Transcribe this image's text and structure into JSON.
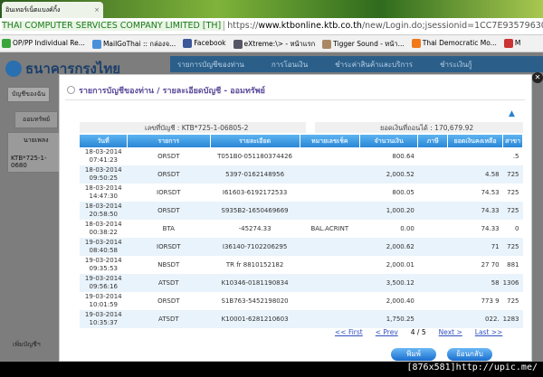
{
  "browser": {
    "tab_title": "อินเทอร์เน็ตแบงค์กิ้ง",
    "tab_close": "×",
    "ev_cert": "THAI COMPUTER SERVICES COMPANY LIMITED [TH]",
    "url_scheme": "https://",
    "url_domain": "www.ktbonline.ktb.co.th",
    "url_rest": "/new/Login.do;jsessionid=1CC7E93579630D",
    "bookmarks": [
      {
        "label": "OP/PP Individual Re...",
        "color": "#3aa53a"
      },
      {
        "label": "MailGoThai :: กล่องจ...",
        "color": "#4a90d9"
      },
      {
        "label": "Facebook",
        "color": "#3b5998"
      },
      {
        "label": "eXtreme:\\> - หน้าแรก",
        "color": "#556"
      },
      {
        "label": "Tigger Sound - หน้า...",
        "color": "#a86"
      },
      {
        "label": "Thai Democratic Mo...",
        "color": "#f07a1a"
      },
      {
        "label": "M",
        "color": "#c33"
      }
    ]
  },
  "site": {
    "logo": "ธนาคารกรุงไทย",
    "nav": [
      "รายการบัญชีของท่าน",
      "การโอนเงิน",
      "ชำระค่าสินค้าและบริการ",
      "ชำระเงินกู้"
    ],
    "left_tab": "บัญชีของฉัน",
    "sub_tab": "ออมทรัพย์",
    "acct_name": "นายเพลง",
    "acct_no": "KTB*725-1-0680",
    "add_account": "เพิ่มบัญชีฯ"
  },
  "modal": {
    "title": "รายการบัญชีของท่าน / รายละเอียดบัญชี - ออมทรัพย์",
    "account_label": "เลขที่บัญชี : KTB*725-1-06805-2",
    "balance_label": "ยอดเงินที่ถอนได้ : 170,679.92",
    "columns": [
      "วันที่",
      "รายการ",
      "รายละเอียด",
      "หมายเลขเช็ค",
      "จำนวนเงิน",
      "ภาษี",
      "ยอดเงินคงเหลือ",
      "สาขา"
    ],
    "rows": [
      {
        "date": "18-03-2014",
        "time": "07:41:23",
        "type": "ORSDT",
        "detail": "T051B0-051180374426",
        "cheque": "",
        "amount": "800.64",
        "tax": "",
        "balance": "",
        "branch": ".5"
      },
      {
        "date": "18-03-2014",
        "time": "09:50:25",
        "type": "ORSDT",
        "detail": "5397-0162148956",
        "cheque": "",
        "amount": "2,000.52",
        "tax": "",
        "balance": "4.58",
        "branch": "725"
      },
      {
        "date": "18-03-2014",
        "time": "14:47:30",
        "type": "IORSDT",
        "detail": "I61603-6192172533",
        "cheque": "",
        "amount": "800.05",
        "tax": "",
        "balance": "74.53",
        "branch": "725"
      },
      {
        "date": "18-03-2014",
        "time": "20:58:50",
        "type": "ORSDT",
        "detail": "S935B2-1650469669",
        "cheque": "",
        "amount": "1,000.20",
        "tax": "",
        "balance": "74.33",
        "branch": "725"
      },
      {
        "date": "18-03-2014",
        "time": "00:38:22",
        "type": "BTA",
        "detail": "-45274.33",
        "cheque": "BAL.ACRINT",
        "amount": "0.00",
        "tax": "",
        "balance": "74.33",
        "branch": "0"
      },
      {
        "date": "19-03-2014",
        "time": "08:40:58",
        "type": "IORSDT",
        "detail": "I36140-7102206295",
        "cheque": "",
        "amount": "2,000.62",
        "tax": "",
        "balance": "71",
        "branch": "725"
      },
      {
        "date": "19-03-2014",
        "time": "09:35:53",
        "type": "NBSDT",
        "detail": "TR fr 8810152182",
        "cheque": "",
        "amount": "2,000.01",
        "tax": "",
        "balance": "27 70",
        "branch": "881"
      },
      {
        "date": "19-03-2014",
        "time": "09:56:16",
        "type": "ATSDT",
        "detail": "K10346-0181190834",
        "cheque": "",
        "amount": "3,500.12",
        "tax": "",
        "balance": "58",
        "branch": "1306"
      },
      {
        "date": "19-03-2014",
        "time": "10:01:59",
        "type": "ORSDT",
        "detail": "S1B763-5452198020",
        "cheque": "",
        "amount": "2,000.40",
        "tax": "",
        "balance": "773 9",
        "branch": "725"
      },
      {
        "date": "19-03-2014",
        "time": "10:35:37",
        "type": "ATSDT",
        "detail": "K10001-6281210603",
        "cheque": "",
        "amount": "1,750.25",
        "tax": "",
        "balance": "022.",
        "branch": "1283"
      }
    ],
    "pager": {
      "first": "<< First",
      "prev": "< Prev",
      "page": "4 / 5",
      "next": "Next >",
      "last": "Last >>"
    },
    "print_button": "พิมพ์",
    "back_button": "ย้อนกลับ"
  },
  "watermark": "[876x581]http://upic.me/"
}
